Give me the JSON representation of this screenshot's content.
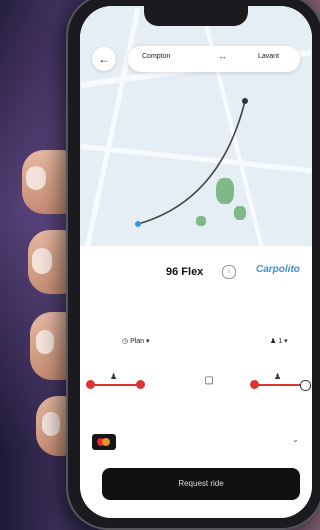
{
  "route": {
    "from": "Compton",
    "to": "Lavant"
  },
  "car": {
    "name": "96 Flex",
    "subtitle": "",
    "brand": "Carpolito"
  },
  "options": {
    "left_label": "",
    "plan": "Plan",
    "right_label": "",
    "passengers": "1"
  },
  "controls": [
    {
      "label": ""
    },
    {
      "label": ""
    },
    {
      "label": ""
    }
  ],
  "payment": {
    "label": ""
  },
  "request_label": "Request ride",
  "colors": {
    "accent": "#d33333",
    "brand": "#3a8fd6",
    "route": "#444444"
  }
}
